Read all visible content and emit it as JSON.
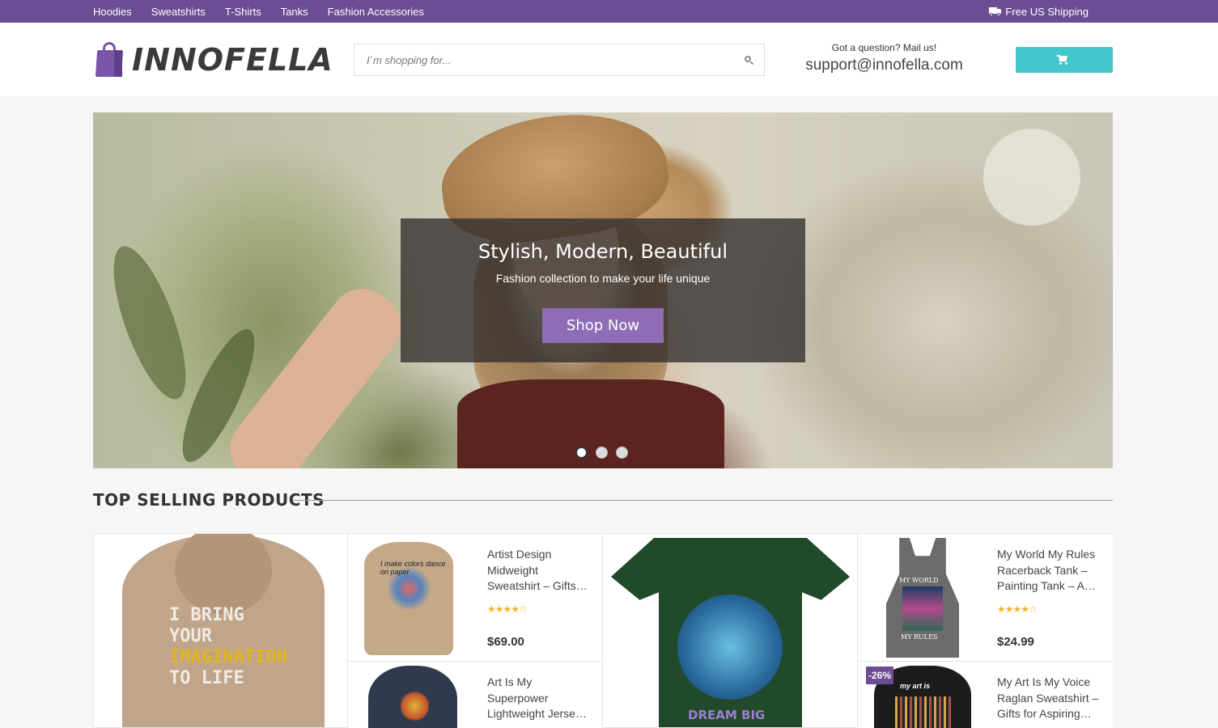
{
  "topbar": {
    "nav": [
      "Hoodies",
      "Sweatshirts",
      "T-Shirts",
      "Tanks",
      "Fashion Accessories"
    ],
    "shipping": "Free US Shipping",
    "shipping_icon": "truck-icon"
  },
  "header": {
    "logo": "INNOFELLA",
    "search_placeholder": "I`m shopping for...",
    "contact_question": "Got a question? Mail us!",
    "contact_email": "support@innofella.com",
    "cart_icon": "cart-icon"
  },
  "hero": {
    "title": "Stylish, Modern, Beautiful",
    "subtitle": "Fashion collection to make your life unique",
    "button": "Shop Now",
    "slides": 3,
    "active_slide": 1
  },
  "section": {
    "title": "TOP SELLING PRODUCTS"
  },
  "products": [
    {
      "title": "Artist Design Midweight Sweatshirt – Gifts…",
      "rating": 4.5,
      "price": "$69.00"
    },
    {
      "title": "My World My Rules Racerback Tank – Painting Tank – A…",
      "rating": 4.5,
      "price": "$24.99"
    },
    {
      "title": "Art Is My Superpower Lightweight Jerse…"
    },
    {
      "title": "My Art Is My Voice Raglan Sweatshirt – Gifts for Aspiring…",
      "badge": "-26%"
    }
  ],
  "art_text": {
    "hoodie_big": [
      "I BRING",
      "YOUR",
      "IMAGINATION",
      "TO LIFE"
    ],
    "sweat_small": "I make colors dance on paper",
    "tee": "DREAM BIG",
    "tank_top": "MY WORLD",
    "tank_bottom": "MY RULES",
    "sweat2": "my art is"
  },
  "colors": {
    "topbar": "#6a4d93",
    "accent_cart": "#44c7cc",
    "shop_button": "#8e6db6",
    "stars": "#f0b429"
  }
}
